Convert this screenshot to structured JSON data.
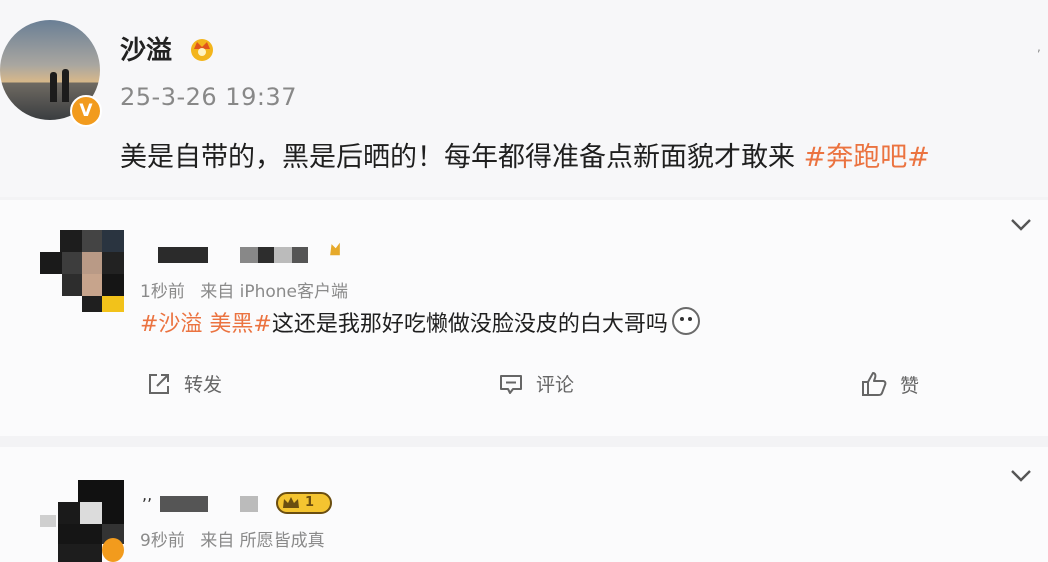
{
  "post": {
    "username": "沙溢",
    "timestamp": "25-3-26 19:37",
    "text": "美是自带的，黑是后晒的！每年都得准备点新面貌才敢来",
    "hashtag": "#奔跑吧#",
    "verified_mark": "V",
    "top_mark": ","
  },
  "comments": [
    {
      "time": "1秒前",
      "source": "来自 iPhone客户端",
      "hashtag_part": "#沙溢 美黑#",
      "text": "这还是我那好吃懒做没脸没皮的白大哥吗",
      "actions": {
        "repost": "转发",
        "comment": "评论",
        "like": "赞"
      }
    },
    {
      "time": "9秒前",
      "source": "来自 所愿皆成真",
      "name_prefix": ",,",
      "level": "1"
    }
  ],
  "colors": {
    "hashtag": "#eb7340",
    "verified": "#f29b1d",
    "meta": "#8a8a8a"
  }
}
